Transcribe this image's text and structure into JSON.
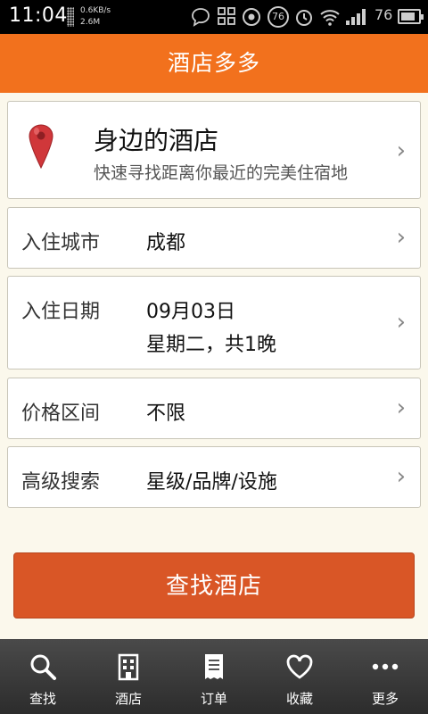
{
  "status_bar": {
    "time": "11:04",
    "net_speed": "0.6KB/s",
    "net_total": "2.6M",
    "notif_count": "76",
    "battery_level": "76"
  },
  "header": {
    "title": "酒店多多"
  },
  "nearby": {
    "title": "身边的酒店",
    "subtitle": "快速寻找距离你最近的完美住宿地",
    "icon": "map-pin-icon"
  },
  "form": {
    "city": {
      "label": "入住城市",
      "value": "成都"
    },
    "date": {
      "label": "入住日期",
      "value_line1": "09月03日",
      "value_line2": "星期二，共1晚"
    },
    "price": {
      "label": "价格区间",
      "value": "不限"
    },
    "advanced": {
      "label": "高级搜索",
      "value": "星级/品牌/设施"
    }
  },
  "search_button": {
    "label": "查找酒店"
  },
  "bottom_nav": {
    "items": [
      {
        "label": "查找",
        "icon": "search-icon"
      },
      {
        "label": "酒店",
        "icon": "hotel-building-icon"
      },
      {
        "label": "订单",
        "icon": "receipt-icon"
      },
      {
        "label": "收藏",
        "icon": "heart-icon"
      },
      {
        "label": "更多",
        "icon": "more-dots-icon"
      }
    ]
  },
  "colors": {
    "brand": "#f2711d",
    "button": "#d95626",
    "background": "#fbf8ec",
    "nav": "#3a3a3a"
  }
}
